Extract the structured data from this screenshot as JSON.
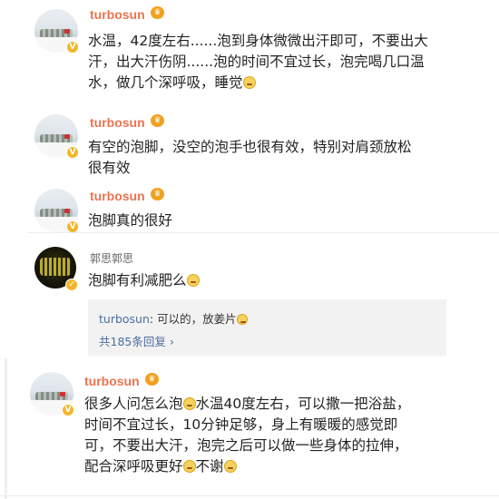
{
  "comments": [
    {
      "username": "turbosun",
      "badge": "V",
      "lines": [
        "水温，42度左右......泡到身体微微出汗即可，不要出大",
        "汗，出大汗伤阴......泡的时间不宜过长，泡完喝几口温",
        "水，做几个深呼吸，睡觉"
      ],
      "emoji": "smile"
    },
    {
      "username": "turbosun",
      "badge": "V",
      "lines": [
        "有空的泡脚，没空的泡手也很有效，特别对肩颈放松",
        "很有效"
      ]
    },
    {
      "username": "turbosun",
      "badge": "V",
      "lines": [
        "泡脚真的很好"
      ]
    },
    {
      "username": "郭思郭思",
      "lines": [
        "泡脚有利减肥么"
      ],
      "emoji": "grin",
      "reply": {
        "author": "turbosun",
        "text": ": 可以的，放姜片",
        "emoji": "smile",
        "count_label": "共185条回复",
        "chevron": "›"
      }
    },
    {
      "username": "turbosun",
      "badge": "V",
      "lines": [
        "很多人问怎么泡",
        "水温40度左右，可以撒一把浴盐，",
        "时间不宜过长，10分钟足够，身上有暖暖的感觉即",
        "可，不要出大汗，泡完之后可以做一些身体的拉伸，",
        "配合深呼吸更好",
        "不谢"
      ]
    }
  ],
  "colors": {
    "username": "#eb7350",
    "link": "#4b6e9e",
    "reply_bg": "#f2f2f2"
  },
  "icons": [
    "vip-crown-icon",
    "verified-badge-icon",
    "emoji-icon",
    "chevron-right-icon"
  ]
}
